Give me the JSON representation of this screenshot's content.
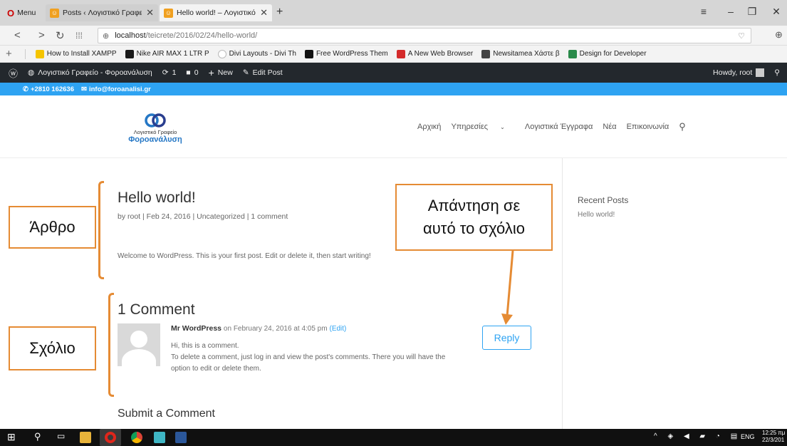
{
  "browser": {
    "menu_label": "Menu",
    "tabs": [
      {
        "title": "Posts ‹ Λογιστικό Γραφείο"
      },
      {
        "title": "Hello world! – Λογιστικό Γ"
      }
    ],
    "new_tab": "+",
    "url_host": "localhost",
    "url_path": "/teicrete/2016/02/24/hello-world/"
  },
  "bookmarks": [
    {
      "label": "How to Install XAMPP",
      "color": "#f5c400"
    },
    {
      "label": "Nike AIR MAX 1 LTR P",
      "color": "#1a1a1a"
    },
    {
      "label": "Divi Layouts - Divi Th",
      "color": "#bbbbbb"
    },
    {
      "label": "Free WordPress Them",
      "color": "#111111"
    },
    {
      "label": "A New Web Browser",
      "color": "#d42b2b"
    },
    {
      "label": "Newsitamea Χάστε β",
      "color": "#444444"
    },
    {
      "label": "Design for Developer",
      "color": "#2a8a4a"
    }
  ],
  "wp_admin": {
    "site_name": "Λογιστικό Γραφείο - Φοροανάλυση",
    "updates": "1",
    "comments": "0",
    "new_label": "New",
    "edit_label": "Edit Post",
    "howdy": "Howdy, root"
  },
  "topinfo": {
    "phone": "+2810 162636",
    "email": "info@foroanalisi.gr"
  },
  "logo": {
    "line1": "Λογιστικό Γραφείο",
    "line2": "Φοροανάλυση"
  },
  "nav": [
    "Αρχική",
    "Υπηρεσίες",
    "Λογιστικά Έγγραφα",
    "Νέα",
    "Επικοινωνία"
  ],
  "post": {
    "title": "Hello world!",
    "meta": "by root | Feb 24, 2016 | Uncategorized | 1 comment",
    "body": "Welcome to WordPress. This is your first post. Edit or delete it, then start writing!"
  },
  "comments": {
    "heading": "1 Comment",
    "author": "Mr WordPress",
    "date": "on February 24, 2016 at 4:05 pm",
    "edit": "(Edit)",
    "line1": "Hi, this is a comment.",
    "line2": "To delete a comment, just log in and view the post's comments. There you will have the",
    "line3": "option to edit or delete them.",
    "reply": "Reply",
    "submit_heading": "Submit a Comment"
  },
  "sidebar": {
    "heading": "Recent Posts",
    "item": "Hello world!"
  },
  "annotations": {
    "article": "Άρθρο",
    "comment": "Σχόλιο",
    "reply_line1": "Απάντηση σε",
    "reply_line2": "αυτό το σχόλιο"
  },
  "taskbar": {
    "lang": "ENG",
    "time": "12:25 πμ",
    "date": "22/3/201"
  },
  "colors": {
    "accent": "#2ea3f2",
    "annotation": "#e58b34",
    "admin_bar": "#23282d"
  }
}
